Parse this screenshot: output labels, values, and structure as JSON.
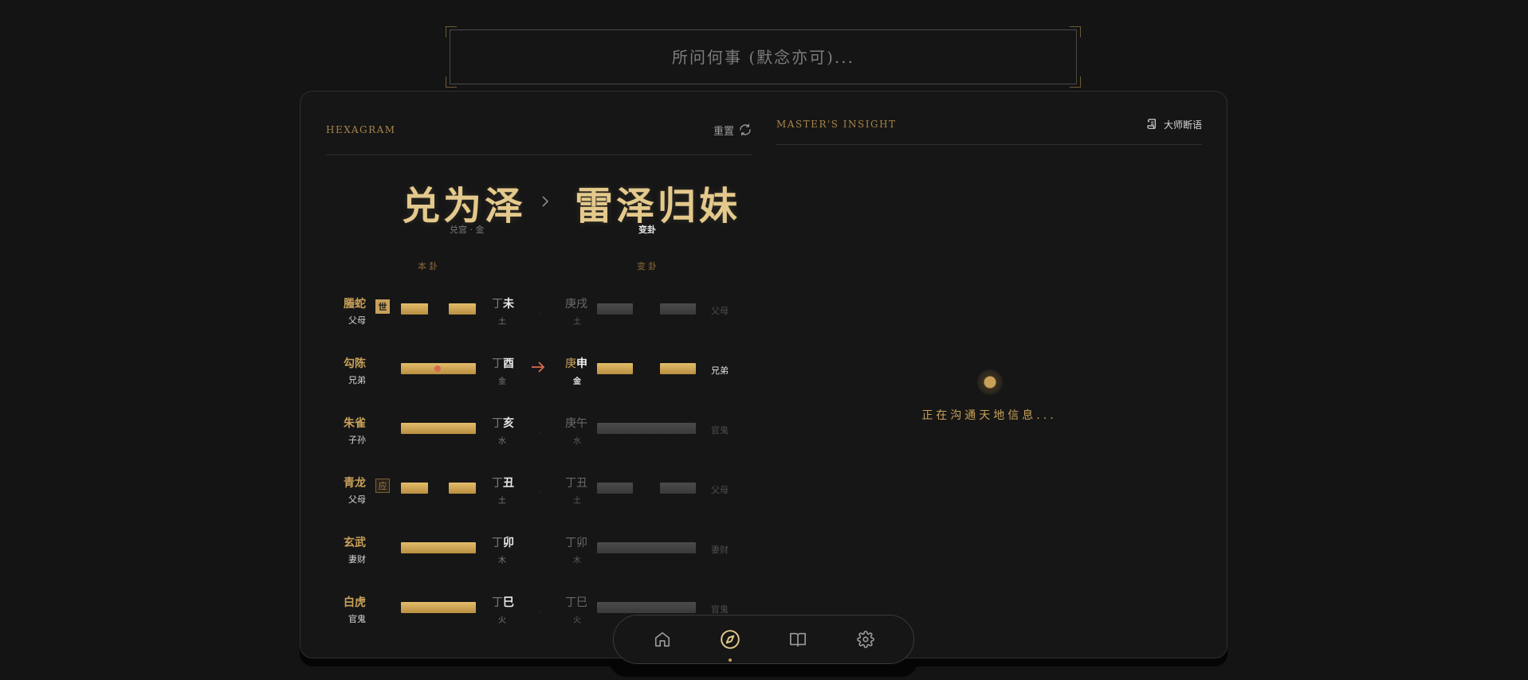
{
  "question": {
    "placeholder": "所问何事 (默念亦可)..."
  },
  "hexagram_panel": {
    "title": "HEXAGRAM",
    "reset_label": "重置",
    "main_name": "兑为泽",
    "main_sub": "兑宫 · 金",
    "changed_name": "雷泽归妹",
    "changed_sub": "变卦",
    "col_main": "本卦",
    "col_changed": "变卦",
    "rows": [
      {
        "god": "螣蛇",
        "relation": "父母",
        "mark": "世",
        "gan": "丁",
        "zhi": "未",
        "element": "土",
        "line": "yin",
        "moving": false,
        "c_gan": "庚",
        "c_zhi": "戌",
        "c_element": "土",
        "c_line": "yin",
        "c_relation": "父母"
      },
      {
        "god": "勾陈",
        "relation": "兄弟",
        "mark": "",
        "gan": "丁",
        "zhi": "酉",
        "element": "金",
        "line": "yang",
        "moving": true,
        "c_gan": "庚",
        "c_zhi": "申",
        "c_element": "金",
        "c_line": "yin",
        "c_relation": "兄弟"
      },
      {
        "god": "朱雀",
        "relation": "子孙",
        "mark": "",
        "gan": "丁",
        "zhi": "亥",
        "element": "水",
        "line": "yang",
        "moving": false,
        "c_gan": "庚",
        "c_zhi": "午",
        "c_element": "水",
        "c_line": "yang",
        "c_relation": "官鬼"
      },
      {
        "god": "青龙",
        "relation": "父母",
        "mark": "应",
        "gan": "丁",
        "zhi": "丑",
        "element": "土",
        "line": "yin",
        "moving": false,
        "c_gan": "丁",
        "c_zhi": "丑",
        "c_element": "土",
        "c_line": "yin",
        "c_relation": "父母"
      },
      {
        "god": "玄武",
        "relation": "妻财",
        "mark": "",
        "gan": "丁",
        "zhi": "卯",
        "element": "木",
        "line": "yang",
        "moving": false,
        "c_gan": "丁",
        "c_zhi": "卯",
        "c_element": "木",
        "c_line": "yang",
        "c_relation": "妻财"
      },
      {
        "god": "白虎",
        "relation": "官鬼",
        "mark": "",
        "gan": "丁",
        "zhi": "巳",
        "element": "火",
        "line": "yang",
        "moving": false,
        "c_gan": "丁",
        "c_zhi": "巳",
        "c_element": "火",
        "c_line": "yang",
        "c_relation": "官鬼"
      }
    ]
  },
  "insight_panel": {
    "title": "MASTER'S INSIGHT",
    "button_label": "大师断语",
    "loading_text": "正在沟通天地信息..."
  },
  "nav": {
    "items": [
      {
        "name": "home",
        "icon": "home-icon"
      },
      {
        "name": "divine",
        "icon": "compass-icon",
        "active": true
      },
      {
        "name": "library",
        "icon": "book-icon"
      },
      {
        "name": "settings",
        "icon": "gear-icon"
      }
    ]
  },
  "colors": {
    "gold": "#c9a15a",
    "background": "#141414",
    "moving": "#d86b4f"
  }
}
